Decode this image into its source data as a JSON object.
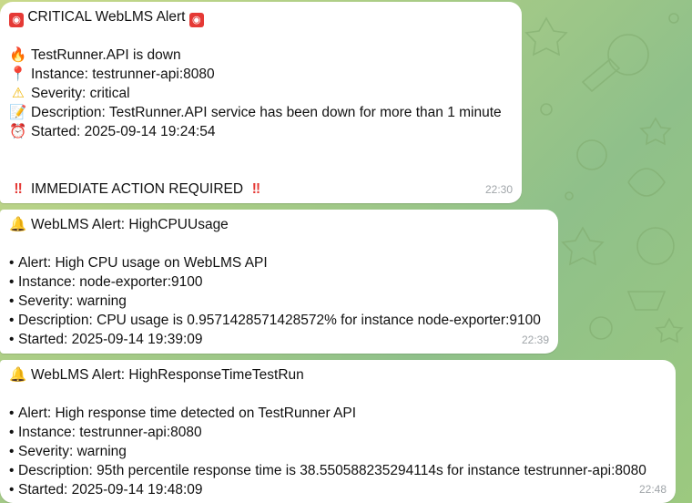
{
  "messages": [
    {
      "title": "CRITICAL WebLMS Alert",
      "title_icon": "siren-icon",
      "lines": [
        {
          "icon": "fire-icon",
          "glyph": "🔥",
          "text": "TestRunner.API is down"
        },
        {
          "icon": "pin-icon",
          "glyph": "📍",
          "text": "Instance: testrunner-api:8080"
        },
        {
          "icon": "warning-icon",
          "glyph": "⚠",
          "text": "Severity: critical"
        },
        {
          "icon": "memo-icon",
          "glyph": "📝",
          "text": "Description: TestRunner.API service has been down for more than 1 minute"
        },
        {
          "icon": "alarm-clock-icon",
          "glyph": "⏰",
          "text": "Started: 2025-09-14 19:24:54"
        }
      ],
      "footer": "IMMEDIATE ACTION REQUIRED",
      "footer_icon": "double-exclamation-icon",
      "time": "22:30"
    },
    {
      "title": "WebLMS Alert: HighCPUUsage",
      "title_icon": "bell-icon",
      "bullets": [
        "Alert: High CPU usage on WebLMS API",
        "Instance: node-exporter:9100",
        "Severity: warning",
        "Description: CPU usage is 0.9571428571428572% for instance node-exporter:9100",
        "Started: 2025-09-14 19:39:09"
      ],
      "time": "22:39"
    },
    {
      "title": "WebLMS Alert: HighResponseTimeTestRun",
      "title_icon": "bell-icon",
      "bullets": [
        "Alert: High response time detected on TestRunner API",
        "Instance: testrunner-api:8080",
        "Severity: warning",
        "Description: 95th percentile response time is 38.550588235294114s for instance testrunner-api:8080",
        "Started: 2025-09-14 19:48:09"
      ],
      "time": "22:48"
    }
  ],
  "colors": {
    "bubble": "#ffffff",
    "timestamp": "#a0a5a9",
    "wallpaper_start": "#c9d98a",
    "wallpaper_end": "#8fc08a",
    "siren": "#e53935",
    "exclamation": "#e53935"
  }
}
